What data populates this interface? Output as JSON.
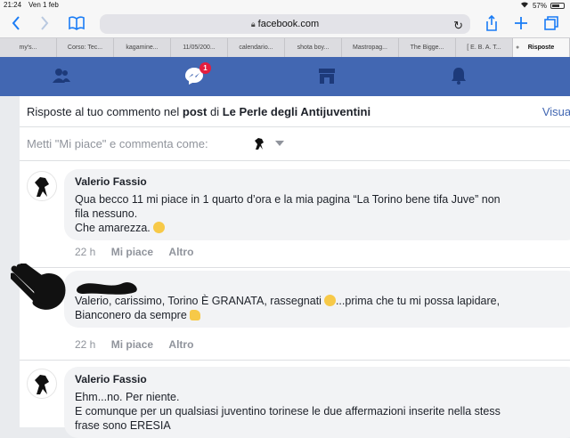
{
  "status": {
    "time": "21:24",
    "date": "Ven 1 feb",
    "battery": "57%"
  },
  "browser": {
    "url": "facebook.com",
    "tabs": [
      "my's...",
      "Corso: Tec...",
      "kagamine...",
      "11/05/200...",
      "calendario...",
      "shota boy...",
      "Mastropag...",
      "The Bigge...",
      "[ E. B. A. T...",
      "Risposte"
    ]
  },
  "fbnav": {
    "messenger_badge": "1"
  },
  "header": {
    "prefix": "Risposte al tuo commento nel",
    "post_word": "post",
    "di": "di",
    "page_name": "Le Perle degli Antijuventini",
    "visual": "Visual"
  },
  "comment_as": "Metti \"Mi piace\" e commenta come:",
  "comments": [
    {
      "author": "Valerio Fassio",
      "lines": [
        "Qua becco 11 mi piace in 1 quarto d’ora e la mia pagina “La Torino bene tifa Juve” non",
        "fila nessuno.",
        "Che amarezza."
      ],
      "time": "22 h",
      "like": "Mi piace",
      "other": "Altro"
    },
    {
      "author": "",
      "lines": [
        "Valerio, carissimo, Torino È GRANATA, rassegnati",
        "...prima che tu mi possa lapidare,",
        "Bianconero da sempre"
      ],
      "time": "22 h",
      "like": "Mi piace",
      "other": "Altro"
    },
    {
      "author": "Valerio Fassio",
      "lines": [
        "Ehm...no. Per niente.",
        "E comunque per un qualsiasi juventino torinese le due affermazioni inserite nella stess",
        "frase sono ERESIA"
      ]
    }
  ]
}
